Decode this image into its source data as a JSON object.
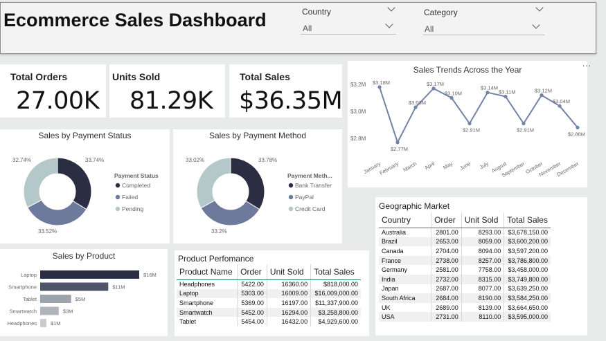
{
  "header": {
    "title": "Ecommerce Sales Dashboard",
    "slicers": [
      {
        "label": "Country",
        "value": "All"
      },
      {
        "label": "Category",
        "value": "All"
      }
    ]
  },
  "more_icon": "...",
  "kpis": [
    {
      "title": "Total Orders",
      "value": "27.00K"
    },
    {
      "title": "Units Sold",
      "value": "81.29K"
    },
    {
      "title": "Total Sales",
      "value": "$36.35M"
    }
  ],
  "colors": {
    "dark": "#2b2d42",
    "mid": "#6d7a9c",
    "light": "#b4c7c9",
    "line": "#7382a7",
    "table_rule": "#2e8b57"
  },
  "chart_data": [
    {
      "type": "line",
      "title": "Sales Trends Across the Year",
      "categories": [
        "January",
        "February",
        "March",
        "April",
        "May",
        "June",
        "July",
        "August",
        "September",
        "October",
        "November",
        "December"
      ],
      "values": [
        3.18,
        2.77,
        3.03,
        3.17,
        3.1,
        2.91,
        3.14,
        3.11,
        2.91,
        3.12,
        3.04,
        2.88
      ],
      "data_labels": [
        "$3.18M",
        "$2.77M",
        "$3.03M",
        "$3.17M",
        "$3.10M",
        "$2.91M",
        "$3.14M",
        "$3.11M",
        "$2.91M",
        "$3.12M",
        "$3.04M",
        "$2.88M"
      ],
      "yticks": [
        "$3.2M",
        "$3.0M",
        "$2.8M"
      ],
      "ylim": [
        2.75,
        3.22
      ]
    },
    {
      "type": "pie",
      "title": "Sales by Payment Status",
      "legend_title": "Payment Status",
      "categories": [
        "Completed",
        "Failed",
        "Pending"
      ],
      "values": [
        33.74,
        33.52,
        32.74
      ],
      "data_labels": [
        "33.74%",
        "33.52%",
        "32.74%"
      ]
    },
    {
      "type": "pie",
      "title": "Sales by Payment Method",
      "legend_title": "Payment Meth...",
      "categories": [
        "Bank Transfer",
        "PayPal",
        "Credit Card"
      ],
      "values": [
        33.78,
        33.2,
        33.02
      ],
      "data_labels": [
        "33.78%",
        "33.2%",
        "33.02%"
      ]
    },
    {
      "type": "bar",
      "title": "Sales by Product",
      "categories": [
        "Laptop",
        "Smartphone",
        "Tablet",
        "Smartwatch",
        "Headphones"
      ],
      "values": [
        16,
        11,
        5,
        3,
        1
      ],
      "data_labels": [
        "$16M",
        "$11M",
        "$5M",
        "$3M",
        "$1M"
      ],
      "colors": [
        "#2b2d42",
        "#4f5569",
        "#9da3ad",
        "#b0b5bd",
        "#c9cdd1"
      ]
    },
    {
      "type": "table",
      "title": "Product Perfomance",
      "columns": [
        "Product Name",
        "Order",
        "Unit Sold",
        "Total Sales"
      ],
      "rows": [
        [
          "Headphones",
          "5422.00",
          "16360.00",
          "$818,000.00"
        ],
        [
          "Laptop",
          "5303.00",
          "16009.00",
          "$16,009,000.00"
        ],
        [
          "Smartphone",
          "5369.00",
          "16197.00",
          "$11,337,900.00"
        ],
        [
          "Smartwatch",
          "5452.00",
          "16294.00",
          "$3,258,800.00"
        ],
        [
          "Tablet",
          "5454.00",
          "16432.00",
          "$4,929,600.00"
        ]
      ]
    },
    {
      "type": "table",
      "title": "Geographic Market",
      "columns": [
        "Country",
        "Order",
        "Unit Sold",
        "Total Sales"
      ],
      "rows": [
        [
          "Australia",
          "2801.00",
          "8293.00",
          "$3,678,150.00"
        ],
        [
          "Brazil",
          "2653.00",
          "8059.00",
          "$3,600,200.00"
        ],
        [
          "Canada",
          "2704.00",
          "8094.00",
          "$3,597,200.00"
        ],
        [
          "France",
          "2738.00",
          "8257.00",
          "$3,786,800.00"
        ],
        [
          "Germany",
          "2581.00",
          "7758.00",
          "$3,458,000.00"
        ],
        [
          "India",
          "2732.00",
          "8315.00",
          "$3,749,800.00"
        ],
        [
          "Japan",
          "2687.00",
          "8077.00",
          "$3,639,250.00"
        ],
        [
          "South Africa",
          "2684.00",
          "8190.00",
          "$3,584,250.00"
        ],
        [
          "UK",
          "2689.00",
          "8139.00",
          "$3,664,650.00"
        ],
        [
          "USA",
          "2731.00",
          "8110.00",
          "$3,595,000.00"
        ]
      ]
    }
  ]
}
